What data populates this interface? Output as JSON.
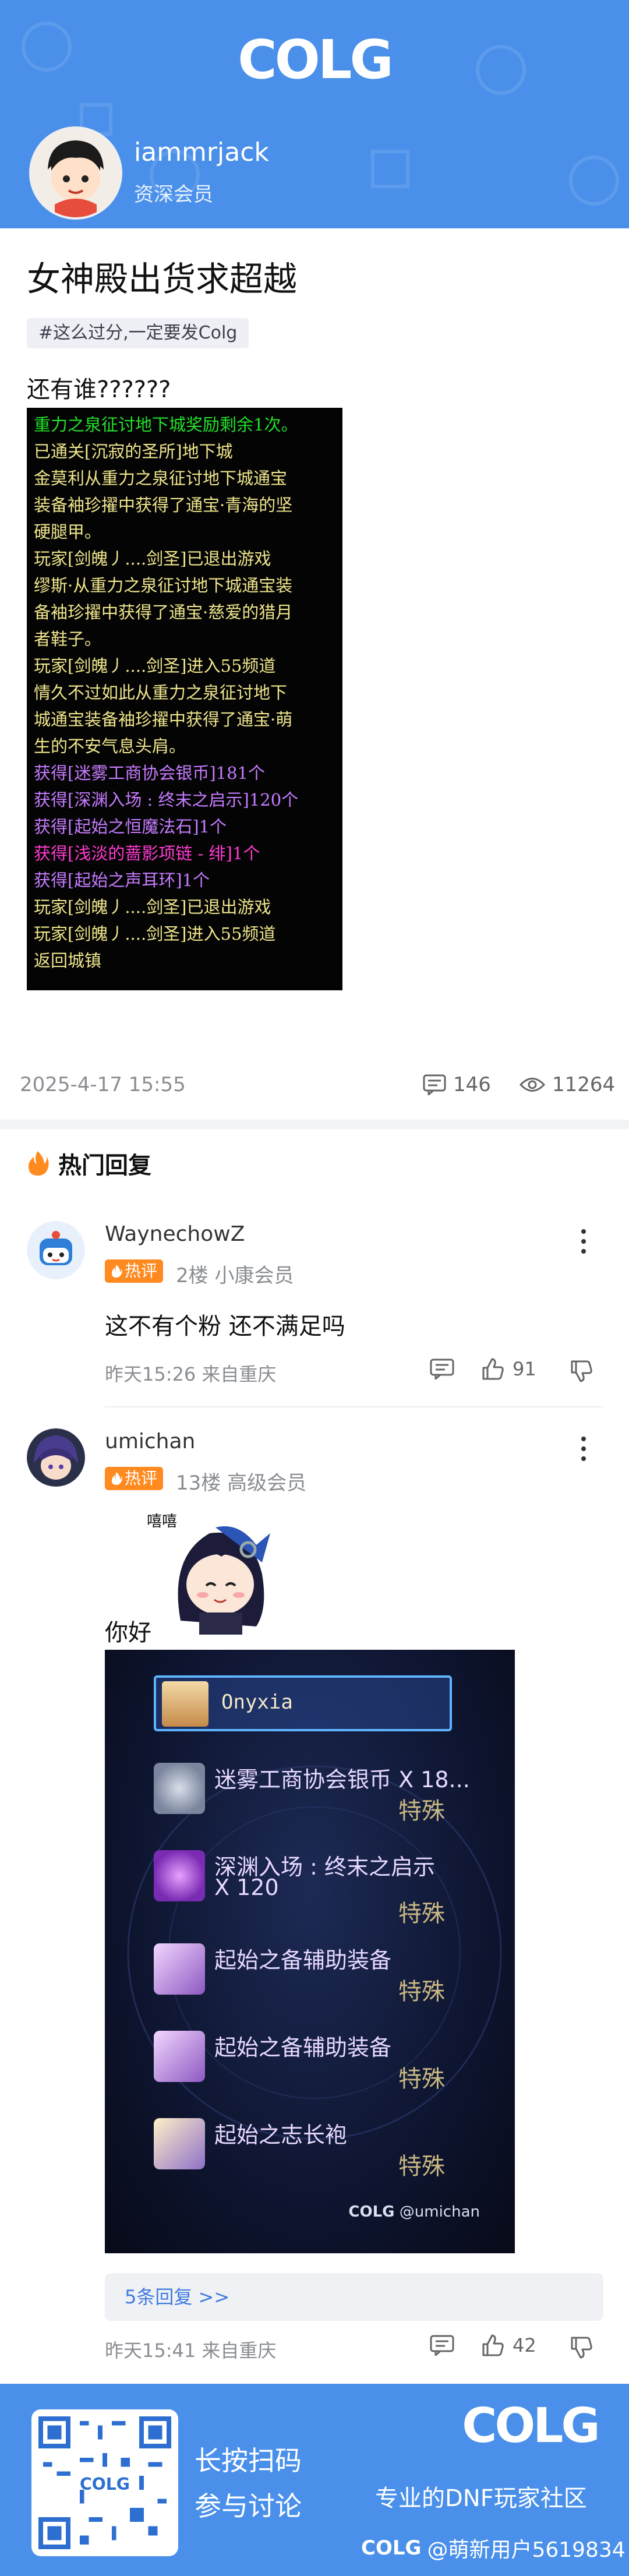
{
  "header": {
    "logo": "COLG",
    "username": "iammrjack",
    "role": "资深会员",
    "brand_color": "#4a90ea"
  },
  "post": {
    "title": "女神殿出货求超越",
    "topic_tag": "#这么过分,一定要发Colg",
    "text": "还有谁??????",
    "screenshot_lines": [
      {
        "text": "重力之泉征讨地下城奖励剩余1次。",
        "color": "#22e12a"
      },
      {
        "text": "已通关[沉寂的圣所]地下城",
        "color": "#f0e68c"
      },
      {
        "text": "金莫利从重力之泉征讨地下城通宝",
        "color": "#f0e68c"
      },
      {
        "text": "装备袖珍擢中获得了通宝·青海的坚",
        "color": "#f0e68c"
      },
      {
        "text": "硬腿甲。",
        "color": "#f0e68c"
      },
      {
        "text": "玩家[剑魄丿....剑圣]已退出游戏",
        "color": "#f0e68c"
      },
      {
        "text": "缪斯·从重力之泉征讨地下城通宝装",
        "color": "#f0e68c"
      },
      {
        "text": "备袖珍擢中获得了通宝·慈爱的猎月",
        "color": "#f0e68c"
      },
      {
        "text": "者鞋子。",
        "color": "#f0e68c"
      },
      {
        "text": "玩家[剑魄丿....剑圣]进入55频道",
        "color": "#f0e68c"
      },
      {
        "text": "情久不过如此从重力之泉征讨地下",
        "color": "#f0e68c"
      },
      {
        "text": "城通宝装备袖珍擢中获得了通宝·萌",
        "color": "#f0e68c"
      },
      {
        "text": "生的不安气息头肩。",
        "color": "#f0e68c"
      },
      {
        "text": "获得[迷雾工商协会银币]181个",
        "color": "#c67bff"
      },
      {
        "text": "获得[深渊入场 : 终末之启示]120个",
        "color": "#c67bff"
      },
      {
        "text": "获得[起始之恒魔法石]1个",
        "color": "#c67bff"
      },
      {
        "text": "获得[浅淡的蔷影项链 - 绯]1个",
        "color": "#ff3bd1"
      },
      {
        "text": "获得[起始之声耳环]1个",
        "color": "#c67bff"
      },
      {
        "text": "玩家[剑魄丿....剑圣]已退出游戏",
        "color": "#f0e68c"
      },
      {
        "text": "玩家[剑魄丿....剑圣]进入55频道",
        "color": "#f0e68c"
      },
      {
        "text": "返回城镇",
        "color": "#f0e68c"
      }
    ],
    "date": "2025-4-17 15:55",
    "comment_count": "146",
    "view_count": "11264"
  },
  "hot": {
    "heading": "热门回复"
  },
  "comments": [
    {
      "name": "WaynechowZ",
      "badge": "热评",
      "floor": "2楼",
      "level": "小康会员",
      "text": "这不有个粉 还不满足吗",
      "time": "昨天15:26",
      "location": "来自重庆",
      "likes": "91"
    },
    {
      "name": "umichan",
      "badge": "热评",
      "floor": "13楼",
      "level": "高级会员",
      "text": "你好",
      "sticker_caption": "嘻嘻",
      "inventory": {
        "selected": "Onyxia",
        "items": [
          {
            "name": "迷雾工商协会银币 X 18...",
            "tag": "特殊",
            "color": "#9aa7c8"
          },
          {
            "name": "深渊入场 : 终末之启示",
            "name2": "X 120",
            "tag": "特殊",
            "color": "#9b4ad6"
          },
          {
            "name": "起始之备辅助装备",
            "tag": "特殊",
            "color": "#b07ad0"
          },
          {
            "name": "起始之备辅助装备",
            "tag": "特殊",
            "color": "#b07ad0"
          },
          {
            "name": "起始之志长袍",
            "tag": "特殊",
            "color": "#a585c8"
          }
        ],
        "watermark": "@umichan"
      },
      "replies_link": "5条回复 >>",
      "time": "昨天15:41",
      "location": "来自重庆",
      "likes": "42"
    }
  ],
  "footer": {
    "line1": "长按扫码",
    "line2": "参与讨论",
    "slogan": "专业的DNF玩家社区",
    "user": "@萌新用户5619834"
  }
}
